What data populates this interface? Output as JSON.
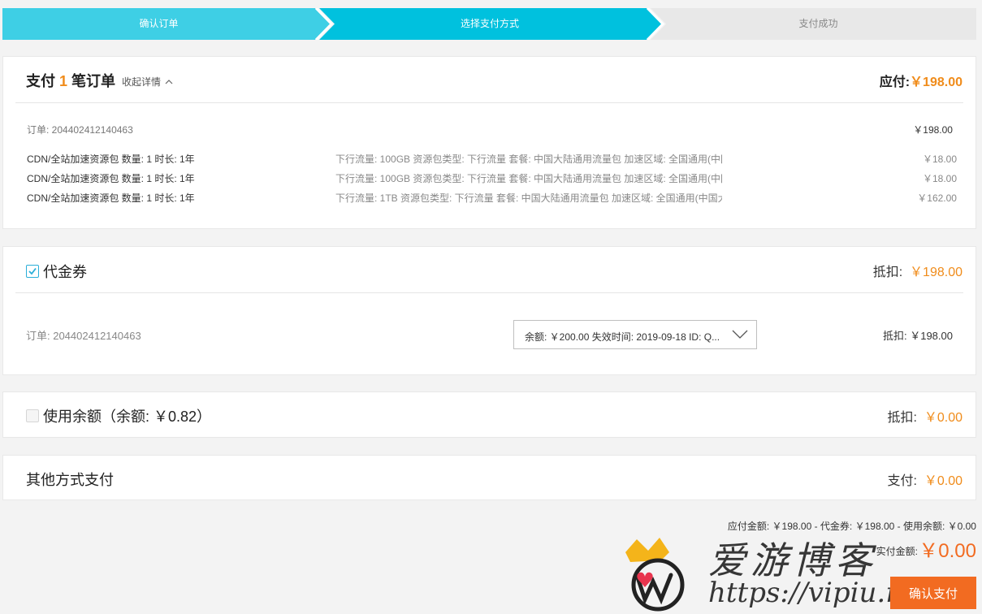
{
  "steps": [
    {
      "label": "确认订单",
      "state": "done"
    },
    {
      "label": "选择支付方式",
      "state": "active"
    },
    {
      "label": "支付成功",
      "state": "pending"
    }
  ],
  "colors": {
    "step_done": "#3ecfe5",
    "step_active": "#00c1de",
    "step_pending": "#e8e8e8",
    "accent_orange": "#f08c1b",
    "button_orange": "#f26b21",
    "checkbox_blue": "#2aaed8"
  },
  "order_summary": {
    "title_prefix": "支付",
    "title_count": "1",
    "title_suffix": "笔订单",
    "toggle_label": "收起详情",
    "toggle_icon": "chevron-up-icon",
    "due_label": "应付:",
    "due_amount": "￥198.00",
    "order_id_label": "订单: 204402412140463",
    "order_total": "￥198.00",
    "items": [
      {
        "name": "CDN/全站加速资源包 数量: 1 时长: 1年",
        "desc": "下行流量: 100GB 资源包类型: 下行流量 套餐: 中国大陆通用流量包 加速区域: 全国通用(中国大陆)",
        "price": "￥18.00"
      },
      {
        "name": "CDN/全站加速资源包 数量: 1 时长: 1年",
        "desc": "下行流量: 100GB 资源包类型: 下行流量 套餐: 中国大陆通用流量包 加速区域: 全国通用(中国大陆)",
        "price": "￥18.00"
      },
      {
        "name": "CDN/全站加速资源包 数量: 1 时长: 1年",
        "desc": "下行流量: 1TB 资源包类型: 下行流量 套餐: 中国大陆通用流量包 加速区域: 全国通用(中国大陆)",
        "price": "￥162.00"
      }
    ]
  },
  "voucher": {
    "checked": true,
    "title": "代金券",
    "deduct_label": "抵扣:",
    "deduct_amount": "￥198.00",
    "order_id_label": "订单: 204402412140463",
    "select_value": "余额: ￥200.00 失效时间: 2019-09-18 ID: Q...",
    "row_deduct": "抵扣: ￥198.00"
  },
  "balance": {
    "checked": false,
    "title": "使用余额（余额: ￥0.82）",
    "deduct_label": "抵扣:",
    "deduct_amount": "￥0.00"
  },
  "other_payment": {
    "title": "其他方式支付",
    "pay_label": "支付:",
    "pay_amount": "￥0.00"
  },
  "footer": {
    "summary": "应付金额: ￥198.00 - 代金券: ￥198.00 - 使用余额: ￥0.00",
    "actual_label": "实付金额:",
    "actual_amount": "￥0.00",
    "confirm_label": "确认支付"
  },
  "watermark": {
    "title": "爱游博客",
    "url": "https://vipiu.net"
  }
}
